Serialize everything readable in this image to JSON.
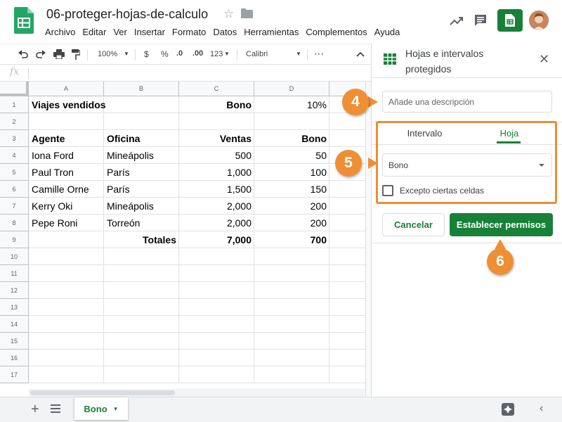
{
  "header": {
    "doc_title": "06-proteger-hojas-de-calculo",
    "menu": [
      "Archivo",
      "Editar",
      "Ver",
      "Insertar",
      "Formato",
      "Datos",
      "Herramientas",
      "Complementos",
      "Ayuda"
    ]
  },
  "toolbar": {
    "zoom": "100%",
    "currency": "$",
    "percent": "%",
    "decimal_decrease": ".0",
    "decimal_increase": ".00",
    "more_formats": "123",
    "font": "Calibri",
    "more": "⋯"
  },
  "formula_bar": {
    "fx": "fx",
    "value": ""
  },
  "sheet": {
    "columns": [
      "A",
      "B",
      "C",
      "D"
    ],
    "rows": [
      "1",
      "2",
      "3",
      "4",
      "5",
      "6",
      "7",
      "8",
      "9",
      "10",
      "11",
      "12",
      "13",
      "14",
      "15",
      "16",
      "17"
    ],
    "cells": {
      "r1": {
        "a": "Viajes vendidos",
        "c": "Bono",
        "d": "10%"
      },
      "r3": {
        "a": "Agente",
        "b": "Oficina",
        "c": "Ventas",
        "d": "Bono"
      },
      "r4": {
        "a": "Iona Ford",
        "b": "Mineápolis",
        "c": "500",
        "d": "50"
      },
      "r5": {
        "a": "Paul Tron",
        "b": "París",
        "c": "1,000",
        "d": "100"
      },
      "r6": {
        "a": "Camille Orne",
        "b": "París",
        "c": "1,500",
        "d": "150"
      },
      "r7": {
        "a": "Kerry Oki",
        "b": "Mineápolis",
        "c": "2,000",
        "d": "200"
      },
      "r8": {
        "a": "Pepe Roni",
        "b": "Torreón",
        "c": "2,000",
        "d": "200"
      },
      "r9": {
        "b": "Totales",
        "c": "7,000",
        "d": "700"
      }
    }
  },
  "bottom": {
    "add_sheet": "+",
    "active_tab": "Bono",
    "collapse": "‹"
  },
  "panel": {
    "title": "Hojas e intervalos protegidos",
    "close": "✕",
    "description_placeholder": "Añade una descripción",
    "tabs": {
      "range": "Intervalo",
      "sheet": "Hoja"
    },
    "selected_sheet": "Bono",
    "except_label": "Excepto ciertas celdas",
    "cancel": "Cancelar",
    "set_permissions": "Establecer permisos"
  },
  "callouts": {
    "step4": "4",
    "step5": "5",
    "step6": "6"
  },
  "colors": {
    "accent_green": "#188038",
    "callout_orange": "#ef8f35"
  },
  "icons": [
    "sheets-logo-icon",
    "star-icon",
    "folder-icon",
    "trend-icon",
    "comment-icon",
    "share-icon",
    "undo-icon",
    "redo-icon",
    "print-icon",
    "paint-format-icon",
    "collapse-toolbar-icon",
    "close-icon",
    "caret-down-icon",
    "add-icon",
    "all-sheets-icon",
    "explore-icon",
    "protected-range-icon"
  ]
}
